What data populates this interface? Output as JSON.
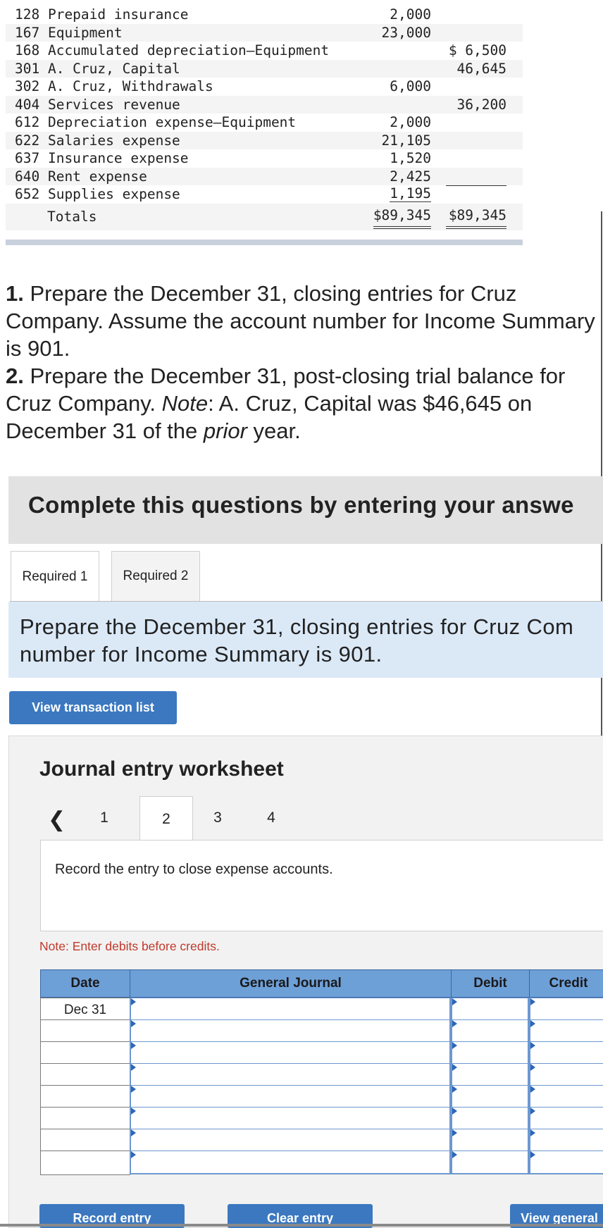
{
  "trial_balance": {
    "rows": [
      {
        "account": "128 Prepaid insurance",
        "debit": "2,000",
        "credit": ""
      },
      {
        "account": "167 Equipment",
        "debit": "23,000",
        "credit": ""
      },
      {
        "account": "168 Accumulated depreciation—Equipment",
        "debit": "",
        "credit": "$ 6,500"
      },
      {
        "account": "301 A. Cruz, Capital",
        "debit": "",
        "credit": "46,645"
      },
      {
        "account": "302 A. Cruz, Withdrawals",
        "debit": "6,000",
        "credit": ""
      },
      {
        "account": "404 Services revenue",
        "debit": "",
        "credit": "36,200"
      },
      {
        "account": "612 Depreciation expense—Equipment",
        "debit": "2,000",
        "credit": ""
      },
      {
        "account": "622 Salaries expense",
        "debit": "21,105",
        "credit": ""
      },
      {
        "account": "637 Insurance expense",
        "debit": "1,520",
        "credit": ""
      },
      {
        "account": "640 Rent expense",
        "debit": "2,425",
        "credit": ""
      },
      {
        "account": "652 Supplies expense",
        "debit": "1,195",
        "credit": ""
      }
    ],
    "totals_label": "Totals",
    "total_debit": "$89,345",
    "total_credit": "$89,345"
  },
  "instructions": {
    "q1_num": "1.",
    "q1_text": " Prepare the December 31, closing entries for Cruz Company. Assume the account number for Income Summary is 901.",
    "q2_num": "2.",
    "q2_text_a": " Prepare the December 31, post-closing trial balance for Cruz Company. ",
    "q2_note": "Note",
    "q2_text_b": ": A. Cruz, Capital was $46,645 on December 31 of the ",
    "q2_prior": "prior",
    "q2_text_c": " year."
  },
  "banner": "Complete this questions by entering your answe",
  "tabs": [
    "Required 1",
    "Required 2"
  ],
  "prompt": "Prepare the December 31, closing entries for Cruz Com\nnumber for Income Summary is 901.",
  "view_transaction_list": "View transaction list",
  "worksheet": {
    "title": "Journal entry worksheet",
    "pages": [
      "1",
      "2",
      "3",
      "4"
    ],
    "active_page": "2",
    "description": "Record the entry to close expense accounts.",
    "note": "Note: Enter debits before credits.",
    "headers": {
      "date": "Date",
      "journal": "General Journal",
      "debit": "Debit",
      "credit": "Credit"
    },
    "first_date": "Dec 31"
  },
  "buttons": {
    "record": "Record entry",
    "clear": "Clear entry",
    "view_general": "View general journal"
  }
}
